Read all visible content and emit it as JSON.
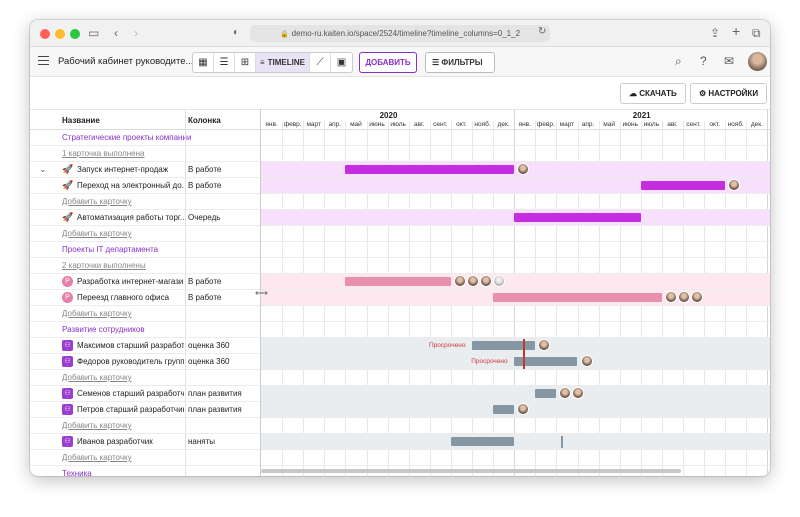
{
  "browser": {
    "url": "demo-ru.kaiten.io/space/2524/timeline?timeline_columns=0_1_2"
  },
  "toolbar": {
    "space_title": "Рабочий кабинет руководите...",
    "timeline_label": "TIMELINE",
    "add_label": "ДОБАВИТЬ",
    "filters_label": "ФИЛЬТРЫ"
  },
  "actions": {
    "download_label": "СКАЧАТЬ",
    "settings_label": "НАСТРОЙКИ"
  },
  "columns": {
    "name_header": "Название",
    "column_header": "Колонка"
  },
  "timeline": {
    "years": [
      "2020",
      "2021"
    ],
    "months": [
      "янв.",
      "февр.",
      "март",
      "апр.",
      "май",
      "июнь",
      "июль",
      "авг.",
      "сент.",
      "окт.",
      "нояб.",
      "дек.",
      "янв.",
      "февр.",
      "март",
      "апр.",
      "май",
      "июнь",
      "июль",
      "авг.",
      "сент.",
      "окт.",
      "нояб.",
      "дек."
    ],
    "overdue_label": "Просрочено"
  },
  "rows": [
    {
      "type": "group",
      "name": "Стратегические проекты компании"
    },
    {
      "type": "done",
      "name": "1 карточка выполнена"
    },
    {
      "type": "card",
      "icon": "rocket",
      "name": "Запуск интернет-продаж",
      "column": "В работе",
      "bar": {
        "start": 4,
        "end": 12,
        "color": "#c52ee0"
      },
      "avatars": 1,
      "expanded": true
    },
    {
      "type": "card",
      "icon": "rocket",
      "name": "Переход на электронный до...",
      "column": "В работе",
      "bar": {
        "start": 18,
        "end": 22,
        "color": "#c52ee0"
      },
      "avatars": 1
    },
    {
      "type": "add",
      "name": "Добавить карточку"
    },
    {
      "type": "card",
      "icon": "rocket",
      "name": "Автоматизация работы торг...",
      "column": "Очередь",
      "bar": {
        "start": 12,
        "end": 18,
        "color": "#c52ee0"
      },
      "avatars": 0
    },
    {
      "type": "add",
      "name": "Добавить карточку"
    },
    {
      "type": "group",
      "name": "Проекты IT департамента"
    },
    {
      "type": "done",
      "name": "2 карточки выполнены"
    },
    {
      "type": "card",
      "icon": "P",
      "name": "Разработка интернет-магази...",
      "column": "В работе",
      "bar": {
        "start": 4,
        "end": 9,
        "color": "#e88fb0"
      },
      "avatars": 4
    },
    {
      "type": "card",
      "icon": "P",
      "name": "Переезд главного офиса",
      "column": "В работе",
      "bar": {
        "start": 11,
        "end": 19,
        "color": "#e88fb0"
      },
      "avatars": 3
    },
    {
      "type": "add",
      "name": "Добавить карточку"
    },
    {
      "type": "group",
      "name": "Развитие сотрудников"
    },
    {
      "type": "card",
      "icon": "person",
      "name": "Максимов старший разработ...",
      "column": "оценка 360",
      "bar": {
        "start": 10,
        "end": 13,
        "color": "#8696a2"
      },
      "avatars": 1,
      "overdue": true
    },
    {
      "type": "card",
      "icon": "person",
      "name": "Федоров руководитель групп...",
      "column": "оценка 360",
      "bar": {
        "start": 12,
        "end": 15,
        "color": "#8696a2"
      },
      "avatars": 1,
      "overdue": true
    },
    {
      "type": "add",
      "name": "Добавить карточку"
    },
    {
      "type": "card",
      "icon": "person",
      "name": "Семенов старший разработч...",
      "column": "план развития",
      "bar": {
        "start": 13,
        "end": 14,
        "color": "#8696a2"
      },
      "avatars": 2
    },
    {
      "type": "card",
      "icon": "person",
      "name": "Петров старший разработчик",
      "column": "план развития",
      "bar": {
        "start": 11,
        "end": 12,
        "color": "#8696a2"
      },
      "avatars": 1
    },
    {
      "type": "add",
      "name": "Добавить карточку"
    },
    {
      "type": "card",
      "icon": "person",
      "name": "Иванов разработчик",
      "column": "наняты",
      "bar": {
        "start": 9,
        "end": 12,
        "color": "#8696a2"
      },
      "avatars": 0
    },
    {
      "type": "add",
      "name": "Добавить карточку"
    },
    {
      "type": "group",
      "name": "Техника"
    }
  ]
}
